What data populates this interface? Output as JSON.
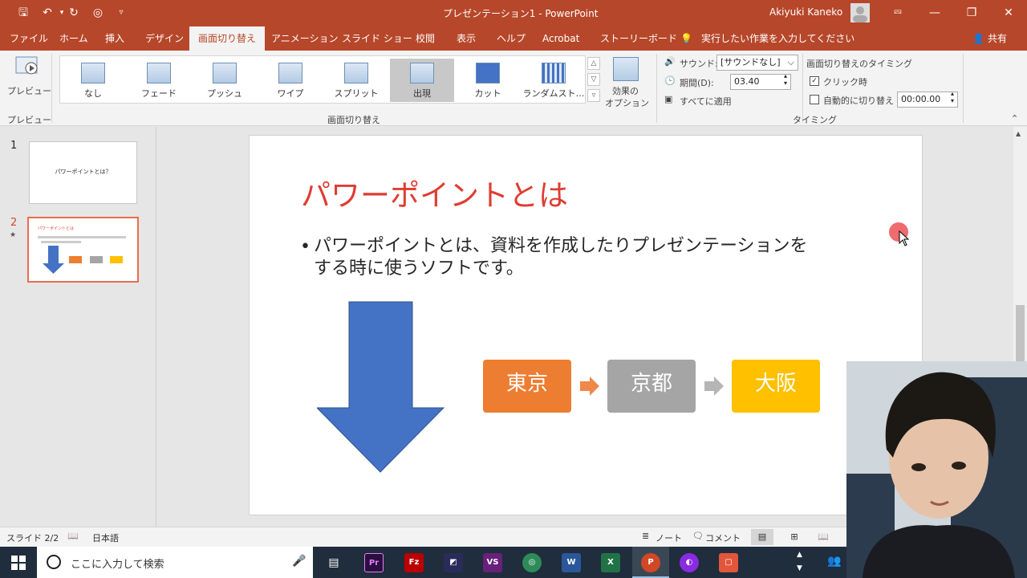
{
  "window": {
    "doc_title": "プレゼンテーション1  -  PowerPoint",
    "user": "Akiyuki Kaneko"
  },
  "tabs": [
    "ファイル",
    "ホーム",
    "挿入",
    "デザイン",
    "画面切り替え",
    "アニメーション",
    "スライド ショー",
    "校閲",
    "表示",
    "ヘルプ",
    "Acrobat",
    "ストーリーボード"
  ],
  "tell_me": "実行したい作業を入力してください",
  "share": "共有",
  "ribbon": {
    "preview_label": "プレビュー",
    "preview_group": "プレビュー",
    "transitions": [
      {
        "label": "なし"
      },
      {
        "label": "フェード"
      },
      {
        "label": "プッシュ"
      },
      {
        "label": "ワイプ"
      },
      {
        "label": "スプリット"
      },
      {
        "label": "出現",
        "selected": true
      },
      {
        "label": "カット"
      },
      {
        "label": "ランダムスト…"
      }
    ],
    "transitions_group": "画面切り替え",
    "effect_options": [
      "効果の",
      "オプション"
    ],
    "sound_label": "サウンド:",
    "sound_value": "[サウンドなし]",
    "duration_label": "期間(D):",
    "duration_value": "03.40",
    "apply_all": "すべてに適用",
    "timing_header": "画面切り替えのタイミング",
    "on_click": "クリック時",
    "on_click_checked": true,
    "auto_after": "自動的に切り替え",
    "auto_after_checked": false,
    "auto_after_value": "00:00.00",
    "timing_group": "タイミング"
  },
  "thumbnails": [
    {
      "num": "1",
      "text": "パワーポイントとは？"
    },
    {
      "num": "2",
      "star": "★",
      "title": "パワーポイントとは"
    }
  ],
  "slide": {
    "title": "パワーポイントとは",
    "bullet_line1": "パワーポイントとは、資料を作成したりプレゼンテーションを",
    "bullet_line2": "する時に使うソフトです。",
    "boxes": [
      {
        "label": "東京",
        "color": "#ed7d31"
      },
      {
        "label": "京都",
        "color": "#a5a5a5"
      },
      {
        "label": "大阪",
        "color": "#ffc000"
      }
    ],
    "title_color": "#e03c31",
    "arrow_color": "#4472c4"
  },
  "status": {
    "slide": "スライド 2/2",
    "lang": "日本語",
    "notes": "ノート",
    "comments": "コメント"
  },
  "taskbar": {
    "search_placeholder": "ここに入力して検索"
  }
}
